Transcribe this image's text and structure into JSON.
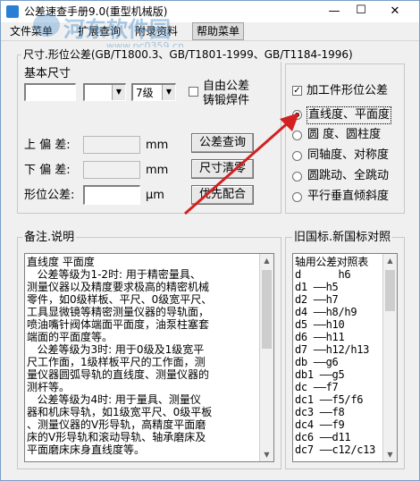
{
  "window": {
    "title": "公差速查手册9.0(重型机械版)",
    "controls": {
      "minimize": "—",
      "maximize": "☐",
      "close": "✕"
    }
  },
  "menu": {
    "items": [
      "文件菜单",
      "扩展查询",
      "附录资料",
      "帮助菜单"
    ],
    "selected_index": 3
  },
  "watermark": {
    "text": "河东软件园",
    "url": "www.pc0359.cn"
  },
  "top_group": {
    "title": "尺寸.形位公差(GB/T1800.3、GB/T1801-1999、GB/T1184-1996)",
    "basic_size_label": "基本尺寸",
    "basic_size_value": "",
    "combo1_value": "",
    "grade_value": "7级",
    "free_tolerance_label": "自由公差",
    "casting_label": "铸锻焊件",
    "free_tolerance_checked": false,
    "upper_dev_label": "上 偏 差:",
    "upper_dev_value": "",
    "upper_dev_unit": "mm",
    "lower_dev_label": "下 偏 差:",
    "lower_dev_value": "",
    "lower_dev_unit": "mm",
    "form_tol_label": "形位公差:",
    "form_tol_value": "",
    "form_tol_unit": "μm",
    "btn_query": "公差查询",
    "btn_clear": "尺寸清零",
    "btn_fit": "优先配合"
  },
  "form_group": {
    "check_label": "加工件形位公差",
    "checked": true,
    "options": [
      "直线度、平面度",
      "圆  度、圆柱度",
      "同轴度、对称度",
      "圆跳动、全跳动",
      "平行垂直倾斜度"
    ],
    "selected_index": 0
  },
  "notes": {
    "title": "备注.说明",
    "lines": [
      "直线度 平面度",
      "   公差等级为1-2时: 用于精密量具、",
      "测量仪器以及精度要求极高的精密机械",
      "零件，如0级样板、平尺、0级宽平尺、",
      "工具显微镜等精密测量仪器的导轨面，",
      "喷油嘴针阀体端面平面度，油泵柱塞套",
      "端面的平面度等。",
      "   公差等级为3时: 用于0级及1级宽平",
      "尺工作面，1级样板平尺的工作面，测",
      "量仪器圆弧导轨的直线度、测量仪器的",
      "测杆等。",
      "   公差等级为4时: 用于量具、测量仪",
      "器和机床导轨，如1级宽平尺、0级平板",
      "、测量仪器的V形导轨，高精度平面磨",
      "床的V形导轨和滚动导轨、轴承磨床及",
      "平面磨床床身直线度等。"
    ]
  },
  "standards": {
    "title": "旧国标.新国标对照",
    "lines": [
      "轴用公差对照表",
      "d      h6",
      "d1 ——h5",
      "d2 ——h7",
      "d4 ——h8/h9",
      "d5 ——h10",
      "d6 ——h11",
      "d7 ——h12/h13",
      "db ——g6",
      "db1 ——g5",
      "dc ——f7",
      "dc1 ——f5/f6",
      "dc3 ——f8",
      "dc4 ——f9",
      "dc6 ——d11",
      "dc7 ——c12/c13"
    ]
  },
  "colors": {
    "arrow": "#d42020",
    "border": "#7a9cc7",
    "accent_watermark": "#468cc8"
  }
}
